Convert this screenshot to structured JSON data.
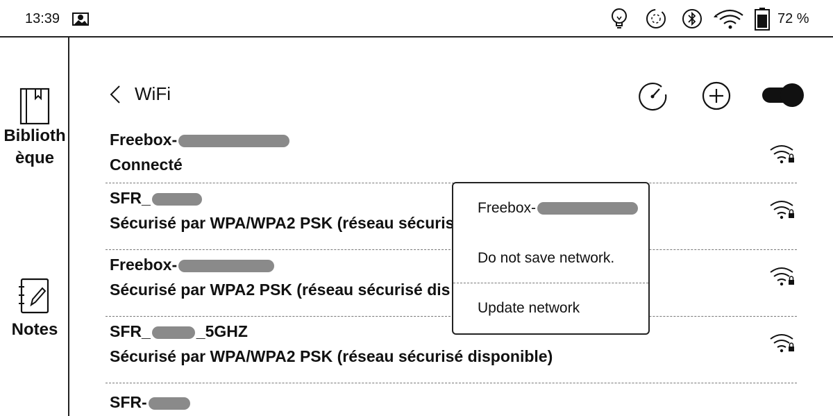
{
  "status_bar": {
    "time": "13:39",
    "battery_percent": "72 %",
    "icons": [
      "image-icon",
      "bulb-icon",
      "sync-icon",
      "bluetooth-icon",
      "wifi-icon",
      "battery-icon"
    ]
  },
  "sidebar": {
    "items": [
      {
        "label_line1": "Biblioth",
        "label_line2": "èque",
        "icon": "library-book-icon"
      },
      {
        "label": "Notes",
        "icon": "notes-icon"
      }
    ]
  },
  "header": {
    "title": "WiFi",
    "actions": [
      "speed-test-icon",
      "add-icon",
      "wifi-toggle"
    ],
    "wifi_enabled": true
  },
  "networks": [
    {
      "name": "Freebox-",
      "status": "Connecté"
    },
    {
      "name": "SFR_",
      "status": "Sécurisé par WPA/WPA2 PSK (réseau sécuris"
    },
    {
      "name": "Freebox-",
      "status": "Sécurisé par WPA2 PSK (réseau sécurisé dis"
    },
    {
      "name_prefix": "SFR_",
      "name_suffix": "_5GHZ",
      "status": "Sécurisé par WPA/WPA2 PSK (réseau sécurisé disponible)"
    },
    {
      "name": "SFR-",
      "status": ""
    }
  ],
  "popup": {
    "items": [
      "Freebox-",
      "Do not save network.",
      "Update network"
    ]
  }
}
